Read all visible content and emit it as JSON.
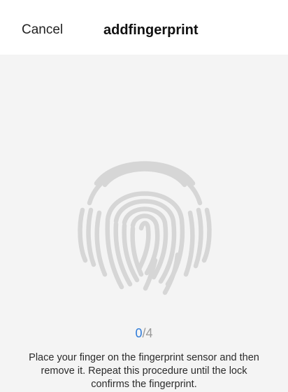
{
  "header": {
    "cancel_label": "Cancel",
    "title": "addfingerprint"
  },
  "fingerprint": {
    "icon": "fingerprint-icon",
    "color": "#d6d6d6"
  },
  "progress": {
    "current": "0",
    "separator": "/",
    "total": "4",
    "current_color": "#2f7bd9"
  },
  "instructions": {
    "text": "Place your finger on the fingerprint sensor and then remove it. Repeat this procedure until the lock confirms the fingerprint."
  }
}
